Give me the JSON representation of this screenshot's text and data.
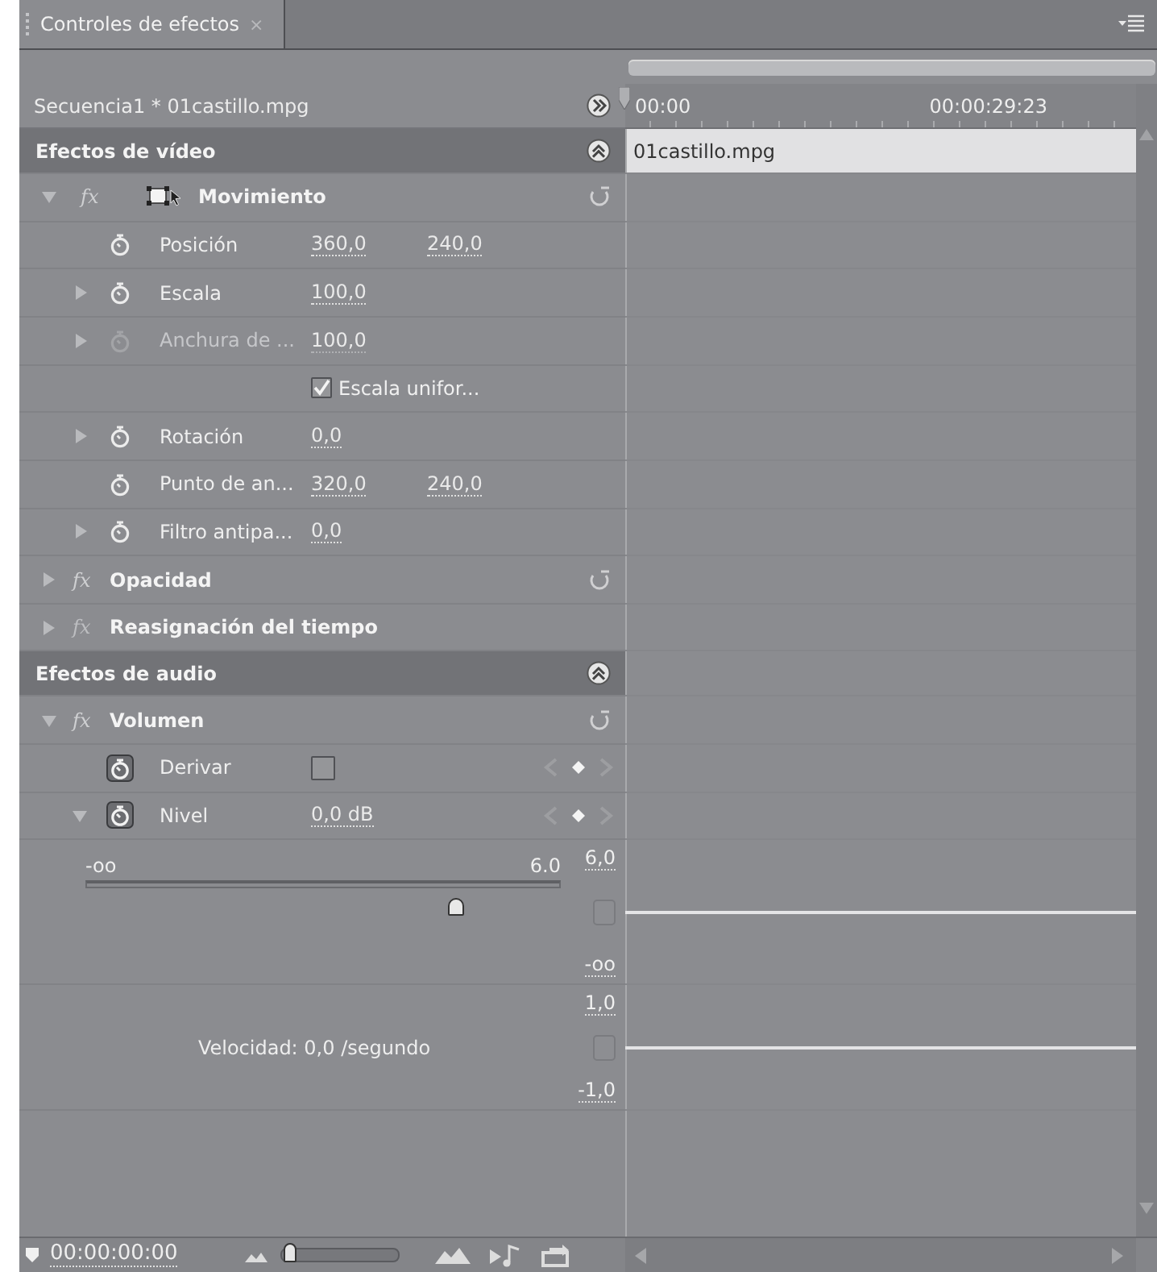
{
  "panel": {
    "title": "Controles de efectos",
    "close": "×",
    "selected": true
  },
  "source": {
    "label": "Secuencia1 * 01castillo.mpg"
  },
  "ruler": {
    "start": "00:00",
    "end": "00:00:29:23"
  },
  "clip": {
    "name": "01castillo.mpg"
  },
  "sections": [
    {
      "label": "Efectos de vídeo",
      "expanded": true,
      "effects": [
        {
          "badge": "fx",
          "label": "Movimiento",
          "expanded": true,
          "enabled": true,
          "transform_icon": true,
          "resettable": true,
          "children": [
            {
              "kind": "property",
              "name": "Posición",
              "expandable": false,
              "disabled": false,
              "animated": false,
              "keyframes": false,
              "values": [
                "360,0",
                "240,0"
              ]
            },
            {
              "kind": "property",
              "name": "Escala",
              "expandable": true,
              "expanded": false,
              "disabled": false,
              "animated": false,
              "keyframes": false,
              "values": [
                "100,0"
              ]
            },
            {
              "kind": "property",
              "name": "Anchura de ...",
              "expandable": true,
              "expanded": false,
              "disabled": true,
              "animated": false,
              "keyframes": false,
              "values": [
                "100,0"
              ]
            },
            {
              "kind": "checkbox",
              "label": "Escala unifor...",
              "checked": true
            },
            {
              "kind": "property",
              "name": "Rotación",
              "expandable": true,
              "expanded": false,
              "disabled": false,
              "animated": false,
              "keyframes": false,
              "values": [
                "0,0"
              ]
            },
            {
              "kind": "property",
              "name": "Punto de an...",
              "expandable": false,
              "disabled": false,
              "animated": false,
              "keyframes": false,
              "values": [
                "320,0",
                "240,0"
              ]
            },
            {
              "kind": "property",
              "name": "Filtro antipa...",
              "expandable": true,
              "expanded": false,
              "disabled": false,
              "animated": false,
              "keyframes": false,
              "values": [
                "0,0"
              ]
            }
          ]
        },
        {
          "badge": "fx",
          "label": "Opacidad",
          "expanded": false,
          "enabled": true,
          "transform_icon": false,
          "resettable": true
        },
        {
          "badge": "fx",
          "label": "Reasignación del tiempo",
          "expanded": false,
          "enabled": false,
          "transform_icon": false,
          "resettable": false
        }
      ]
    },
    {
      "label": "Efectos de audio",
      "expanded": true,
      "effects": [
        {
          "badge": "fx",
          "label": "Volumen",
          "expanded": true,
          "enabled": true,
          "transform_icon": false,
          "resettable": true,
          "children": [
            {
              "kind": "toggle",
              "name": "Derivar",
              "expandable": false,
              "disabled": false,
              "animated": true,
              "keyframes": true,
              "checked": false
            },
            {
              "kind": "property",
              "name": "Nivel",
              "expandable": true,
              "expanded": true,
              "disabled": false,
              "animated": true,
              "keyframes": true,
              "values": [
                "0,0 dB"
              ],
              "children": [
                {
                  "kind": "slider",
                  "max_label": "6,0",
                  "min_label": "-oo",
                  "track_min": "-oo",
                  "track_max": "6.0",
                  "level": 0.78
                },
                {
                  "kind": "velocity",
                  "max_label": "1,0",
                  "min_label": "-1,0",
                  "reading": "Velocidad: 0,0 /segundo"
                }
              ]
            }
          ]
        }
      ]
    }
  ],
  "footer": {
    "time": "00:00:00:00",
    "zoom": {
      "level": 0.02
    }
  }
}
